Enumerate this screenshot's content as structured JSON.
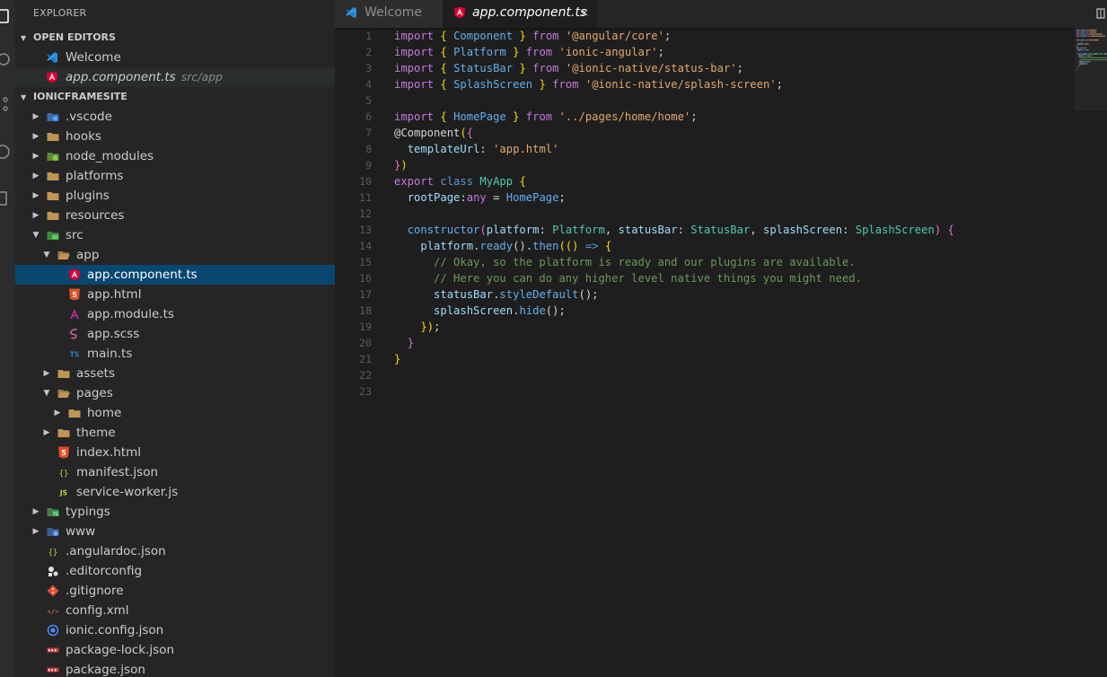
{
  "sidebar": {
    "title": "EXPLORER",
    "open_editors": {
      "header": "OPEN EDITORS",
      "items": [
        {
          "name": "Welcome",
          "path": ""
        },
        {
          "name": "app.component.ts",
          "path": "src/app"
        }
      ]
    },
    "project": {
      "header": "IONICFRAMESITE",
      "items": [
        {
          "label": ".vscode",
          "icon": "vscode-folder-icon",
          "type": "folder",
          "expanded": false,
          "depth": 0
        },
        {
          "label": "hooks",
          "icon": "folder-icon",
          "type": "folder",
          "expanded": false,
          "depth": 0
        },
        {
          "label": "node_modules",
          "icon": "node-folder-icon",
          "type": "folder",
          "expanded": false,
          "depth": 0
        },
        {
          "label": "platforms",
          "icon": "folder-icon",
          "type": "folder",
          "expanded": false,
          "depth": 0
        },
        {
          "label": "plugins",
          "icon": "folder-icon",
          "type": "folder",
          "expanded": false,
          "depth": 0
        },
        {
          "label": "resources",
          "icon": "folder-icon",
          "type": "folder",
          "expanded": false,
          "depth": 0
        },
        {
          "label": "src",
          "icon": "src-folder-icon",
          "type": "folder",
          "expanded": true,
          "depth": 0
        },
        {
          "label": "app",
          "icon": "folder-open-icon",
          "type": "folder",
          "expanded": true,
          "depth": 1
        },
        {
          "label": "app.component.ts",
          "icon": "angular-icon",
          "type": "file",
          "depth": 2,
          "selected": true
        },
        {
          "label": "app.html",
          "icon": "html5-icon",
          "type": "file",
          "depth": 2
        },
        {
          "label": "app.module.ts",
          "icon": "angular-module-icon",
          "type": "file",
          "depth": 2
        },
        {
          "label": "app.scss",
          "icon": "sass-icon",
          "type": "file",
          "depth": 2
        },
        {
          "label": "main.ts",
          "icon": "typescript-icon",
          "type": "file",
          "depth": 2
        },
        {
          "label": "assets",
          "icon": "folder-icon",
          "type": "folder",
          "expanded": false,
          "depth": 1
        },
        {
          "label": "pages",
          "icon": "folder-open-icon",
          "type": "folder",
          "expanded": true,
          "depth": 1
        },
        {
          "label": "home",
          "icon": "folder-icon",
          "type": "folder",
          "expanded": false,
          "depth": 2
        },
        {
          "label": "theme",
          "icon": "folder-icon",
          "type": "folder",
          "expanded": false,
          "depth": 1
        },
        {
          "label": "index.html",
          "icon": "html5-icon",
          "type": "file",
          "depth": 1
        },
        {
          "label": "manifest.json",
          "icon": "json-icon",
          "type": "file",
          "depth": 1
        },
        {
          "label": "service-worker.js",
          "icon": "javascript-icon",
          "type": "file",
          "depth": 1
        },
        {
          "label": "typings",
          "icon": "typings-folder-icon",
          "type": "folder",
          "expanded": false,
          "depth": 0
        },
        {
          "label": "www",
          "icon": "www-folder-icon",
          "type": "folder",
          "expanded": false,
          "depth": 0
        },
        {
          "label": ".angulardoc.json",
          "icon": "json-icon",
          "type": "file",
          "depth": 0
        },
        {
          "label": ".editorconfig",
          "icon": "editorconfig-icon",
          "type": "file",
          "depth": 0
        },
        {
          "label": ".gitignore",
          "icon": "git-icon",
          "type": "file",
          "depth": 0
        },
        {
          "label": "config.xml",
          "icon": "xml-icon",
          "type": "file",
          "depth": 0
        },
        {
          "label": "ionic.config.json",
          "icon": "ionic-icon",
          "type": "file",
          "depth": 0
        },
        {
          "label": "package-lock.json",
          "icon": "npm-icon",
          "type": "file",
          "depth": 0
        },
        {
          "label": "package.json",
          "icon": "npm-icon",
          "type": "file",
          "depth": 0
        }
      ]
    }
  },
  "tabs": [
    {
      "label": "Welcome",
      "icon": "vscode-icon",
      "active": false
    },
    {
      "label": "app.component.ts",
      "icon": "angular-icon",
      "active": true,
      "close": "×"
    }
  ],
  "editor": {
    "lines": [
      [
        [
          "kw",
          "import"
        ],
        [
          "plain",
          " "
        ],
        [
          "brk",
          "{"
        ],
        [
          "plain",
          " "
        ],
        [
          "fn",
          "Component"
        ],
        [
          "plain",
          " "
        ],
        [
          "brk",
          "}"
        ],
        [
          "plain",
          " "
        ],
        [
          "kw",
          "from"
        ],
        [
          "plain",
          " "
        ],
        [
          "str",
          "'@angular/core'"
        ],
        [
          "plain",
          ";"
        ]
      ],
      [
        [
          "kw",
          "import"
        ],
        [
          "plain",
          " "
        ],
        [
          "brk",
          "{"
        ],
        [
          "plain",
          " "
        ],
        [
          "fn",
          "Platform"
        ],
        [
          "plain",
          " "
        ],
        [
          "brk",
          "}"
        ],
        [
          "plain",
          " "
        ],
        [
          "kw",
          "from"
        ],
        [
          "plain",
          " "
        ],
        [
          "str",
          "'ionic-angular'"
        ],
        [
          "plain",
          ";"
        ]
      ],
      [
        [
          "kw",
          "import"
        ],
        [
          "plain",
          " "
        ],
        [
          "brk",
          "{"
        ],
        [
          "plain",
          " "
        ],
        [
          "fn",
          "StatusBar"
        ],
        [
          "plain",
          " "
        ],
        [
          "brk",
          "}"
        ],
        [
          "plain",
          " "
        ],
        [
          "kw",
          "from"
        ],
        [
          "plain",
          " "
        ],
        [
          "str",
          "'@ionic-native/status-bar'"
        ],
        [
          "plain",
          ";"
        ]
      ],
      [
        [
          "kw",
          "import"
        ],
        [
          "plain",
          " "
        ],
        [
          "brk",
          "{"
        ],
        [
          "plain",
          " "
        ],
        [
          "fn",
          "SplashScreen"
        ],
        [
          "plain",
          " "
        ],
        [
          "brk",
          "}"
        ],
        [
          "plain",
          " "
        ],
        [
          "kw",
          "from"
        ],
        [
          "plain",
          " "
        ],
        [
          "str",
          "'@ionic-native/splash-screen'"
        ],
        [
          "plain",
          ";"
        ]
      ],
      [],
      [
        [
          "kw",
          "import"
        ],
        [
          "plain",
          " "
        ],
        [
          "brk",
          "{"
        ],
        [
          "plain",
          " "
        ],
        [
          "fn",
          "HomePage"
        ],
        [
          "plain",
          " "
        ],
        [
          "brk",
          "}"
        ],
        [
          "plain",
          " "
        ],
        [
          "kw",
          "from"
        ],
        [
          "plain",
          " "
        ],
        [
          "str",
          "'../pages/home/home'"
        ],
        [
          "plain",
          ";"
        ]
      ],
      [
        [
          "plain",
          "@Component"
        ],
        [
          "brk",
          "("
        ],
        [
          "pink",
          "{"
        ]
      ],
      [
        [
          "guide",
          "  "
        ],
        [
          "prop",
          "templateUrl"
        ],
        [
          "plain",
          ": "
        ],
        [
          "str",
          "'app.html'"
        ]
      ],
      [
        [
          "pink",
          "}"
        ],
        [
          "brk",
          ")"
        ]
      ],
      [
        [
          "kw",
          "export"
        ],
        [
          "plain",
          " "
        ],
        [
          "kw2",
          "class"
        ],
        [
          "plain",
          " "
        ],
        [
          "typ",
          "MyApp"
        ],
        [
          "plain",
          " "
        ],
        [
          "brk",
          "{"
        ]
      ],
      [
        [
          "guide",
          "  "
        ],
        [
          "prop",
          "rootPage"
        ],
        [
          "plain",
          ":"
        ],
        [
          "kw",
          "any"
        ],
        [
          "plain",
          " = "
        ],
        [
          "fn",
          "HomePage"
        ],
        [
          "plain",
          ";"
        ]
      ],
      [],
      [
        [
          "guide",
          "  "
        ],
        [
          "fn",
          "constructor"
        ],
        [
          "pink",
          "("
        ],
        [
          "prop",
          "platform"
        ],
        [
          "plain",
          ": "
        ],
        [
          "typ",
          "Platform"
        ],
        [
          "plain",
          ", "
        ],
        [
          "prop",
          "statusBar"
        ],
        [
          "plain",
          ": "
        ],
        [
          "typ",
          "StatusBar"
        ],
        [
          "plain",
          ", "
        ],
        [
          "prop",
          "splashScreen"
        ],
        [
          "plain",
          ": "
        ],
        [
          "typ",
          "SplashScreen"
        ],
        [
          "pink",
          ")"
        ],
        [
          "plain",
          " "
        ],
        [
          "pink",
          "{"
        ]
      ],
      [
        [
          "guide",
          "    "
        ],
        [
          "prop",
          "platform"
        ],
        [
          "plain",
          "."
        ],
        [
          "fn",
          "ready"
        ],
        [
          "plain",
          "()."
        ],
        [
          "fn",
          "then"
        ],
        [
          "brk",
          "(()"
        ],
        [
          "plain",
          " "
        ],
        [
          "kw2",
          "=>"
        ],
        [
          "plain",
          " "
        ],
        [
          "brk",
          "{"
        ]
      ],
      [
        [
          "guide",
          "      "
        ],
        [
          "cmt",
          "// Okay, so the platform is ready and our plugins are available."
        ]
      ],
      [
        [
          "guide",
          "      "
        ],
        [
          "cmt",
          "// Here you can do any higher level native things you might need."
        ]
      ],
      [
        [
          "guide",
          "      "
        ],
        [
          "prop",
          "statusBar"
        ],
        [
          "plain",
          "."
        ],
        [
          "fn",
          "styleDefault"
        ],
        [
          "plain",
          "();"
        ]
      ],
      [
        [
          "guide",
          "      "
        ],
        [
          "prop",
          "splashScreen"
        ],
        [
          "plain",
          "."
        ],
        [
          "fn",
          "hide"
        ],
        [
          "plain",
          "();"
        ]
      ],
      [
        [
          "guide",
          "    "
        ],
        [
          "brk",
          "})"
        ],
        [
          "plain",
          ";"
        ]
      ],
      [
        [
          "guide",
          "  "
        ],
        [
          "pink",
          "}"
        ]
      ],
      [
        [
          "brk",
          "}"
        ]
      ],
      [],
      []
    ]
  }
}
